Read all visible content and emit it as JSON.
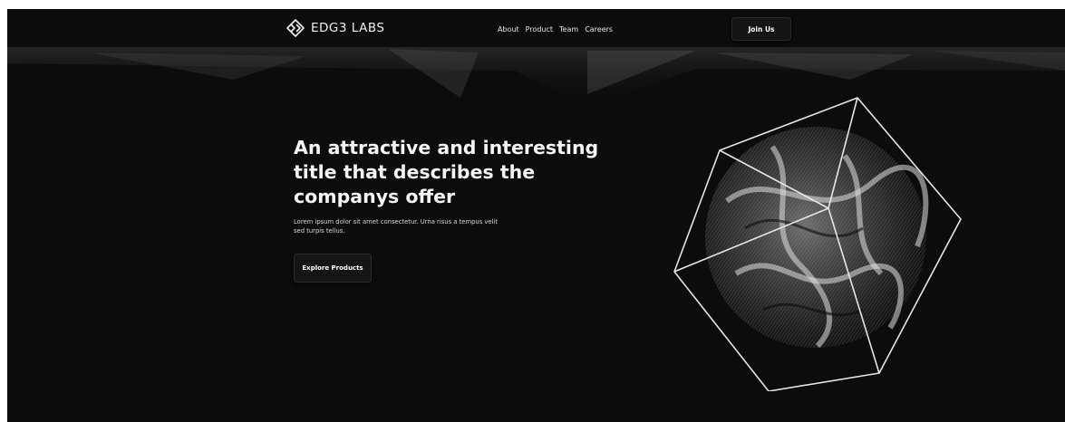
{
  "header": {
    "brand": "EDG3 LABS",
    "brand_icon": "diamond-arrows-logo-icon",
    "nav": [
      {
        "label": "About"
      },
      {
        "label": "Product"
      },
      {
        "label": "Team"
      },
      {
        "label": "Careers"
      }
    ],
    "cta_label": "Join Us"
  },
  "hero": {
    "title": "An attractive and interesting title that describes the companys offer",
    "subtitle": "Lorem ipsum dolor sit amet consectetur. Urna risus a tempus velit sed turpis tellus.",
    "cta_label": "Explore Products",
    "art_icon": "wireframe-cube-particle-sphere-icon"
  },
  "colors": {
    "background": "#0c0c0c",
    "text": "#f5f5f5",
    "button_bg": "#151515"
  }
}
